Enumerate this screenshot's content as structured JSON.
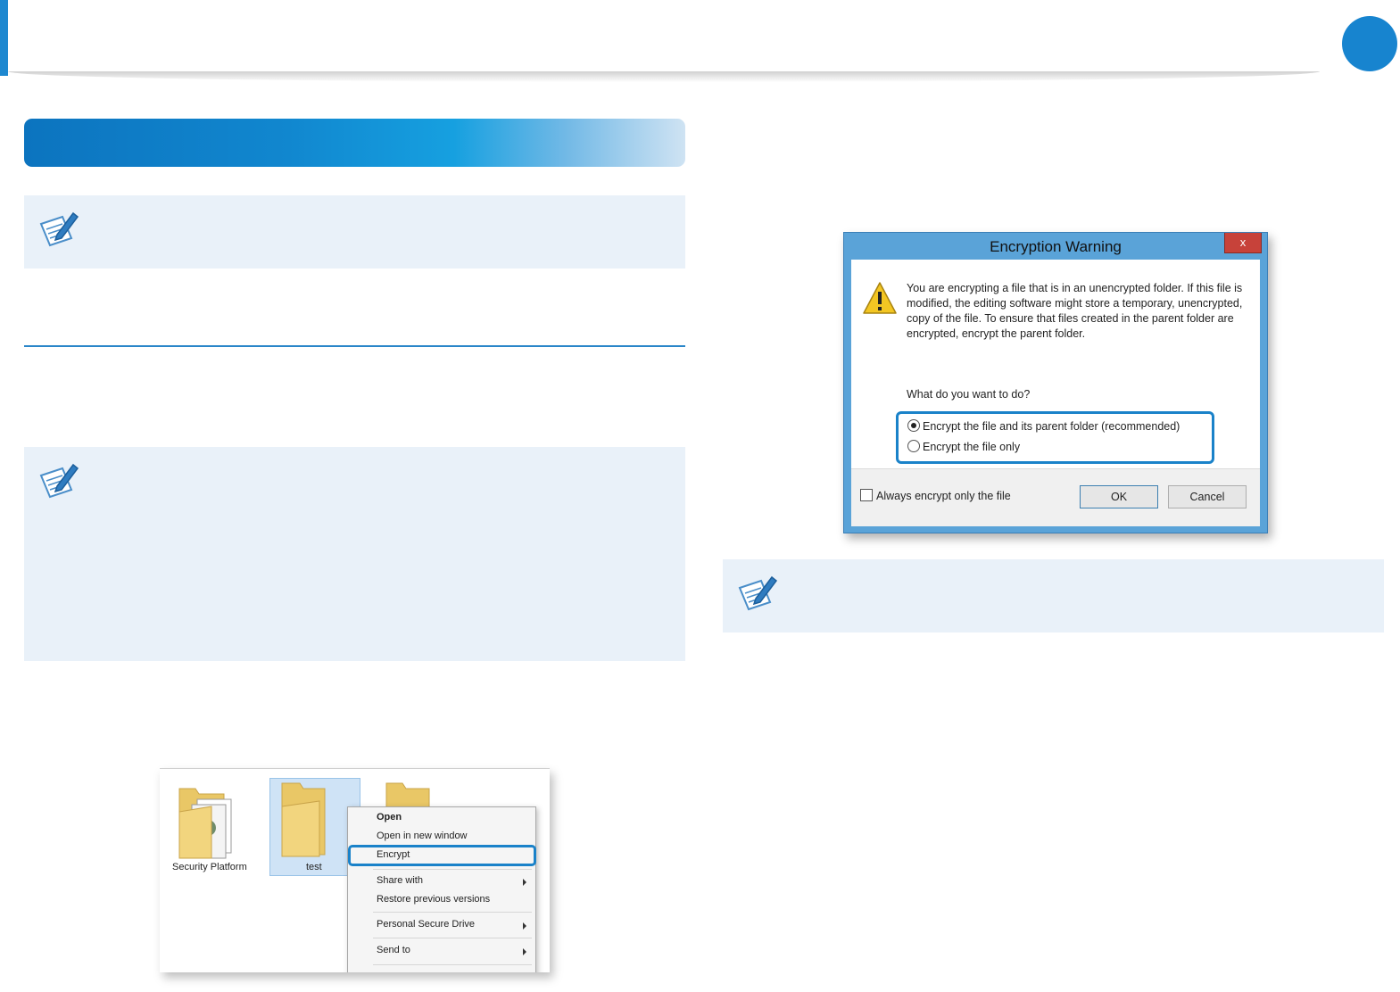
{
  "explorer": {
    "folders": [
      {
        "label": "Security Platform"
      },
      {
        "label": "test"
      },
      {
        "label": ""
      }
    ],
    "context_menu": {
      "items": [
        {
          "label": "Open"
        },
        {
          "label": "Open in new window"
        },
        {
          "label": "Encrypt"
        },
        {
          "label": "Share with"
        },
        {
          "label": "Restore previous versions"
        },
        {
          "label": "Personal Secure Drive"
        },
        {
          "label": "Send to"
        }
      ]
    }
  },
  "dialog": {
    "title": "Encryption Warning",
    "close_label": "x",
    "message": "You are encrypting a file that is in an unencrypted folder. If this file is modified, the editing software might store a temporary, unencrypted, copy of the file. To ensure that files created in the parent folder are encrypted, encrypt the parent folder.",
    "question": "What do you want to do?",
    "options": [
      {
        "label": "Encrypt the file and its parent folder (recommended)",
        "selected": true
      },
      {
        "label": "Encrypt the file only",
        "selected": false
      }
    ],
    "checkbox_label": "Always encrypt only the file",
    "ok_label": "OK",
    "cancel_label": "Cancel"
  },
  "colors": {
    "accent": "#1784cf",
    "note_background": "#e9f1f9",
    "highlight_border": "#1a82c9"
  }
}
